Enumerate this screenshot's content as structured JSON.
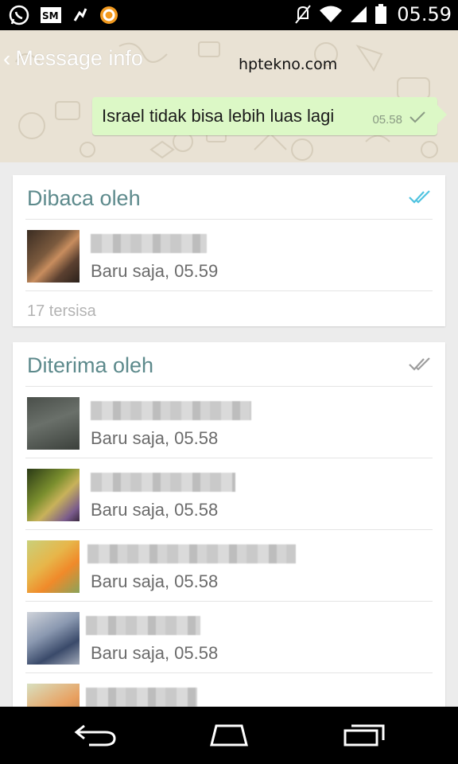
{
  "status_bar": {
    "time": "05.59",
    "left_icons": [
      "whatsapp-icon",
      "sm-icon",
      "notification-icon",
      "app-icon"
    ],
    "right_icons": [
      "mute-icon",
      "wifi-icon",
      "signal-icon",
      "battery-icon"
    ]
  },
  "header": {
    "back_chevron": "‹",
    "title": "Message info",
    "watermark": "hptekno.com"
  },
  "message": {
    "text": "Israel tidak bisa lebih luas lagi",
    "time": "05.58"
  },
  "read_section": {
    "title": "Dibaca oleh",
    "rows": [
      {
        "time": "Baru saja, 05.59"
      }
    ],
    "remaining": "17 tersisa"
  },
  "delivered_section": {
    "title": "Diterima oleh",
    "rows": [
      {
        "time": "Baru saja, 05.58"
      },
      {
        "time": "Baru saja, 05.58"
      },
      {
        "time": "Baru saja, 05.58"
      },
      {
        "time": "Baru saja, 05.58"
      },
      {
        "time": ""
      }
    ]
  },
  "colors": {
    "accent_teal": "#5d8a8c",
    "read_tick_blue": "#4fc3e0",
    "bubble_green": "#dcf8c6"
  },
  "nav_bar": {
    "buttons": [
      "back-icon",
      "home-icon",
      "recents-icon"
    ]
  }
}
